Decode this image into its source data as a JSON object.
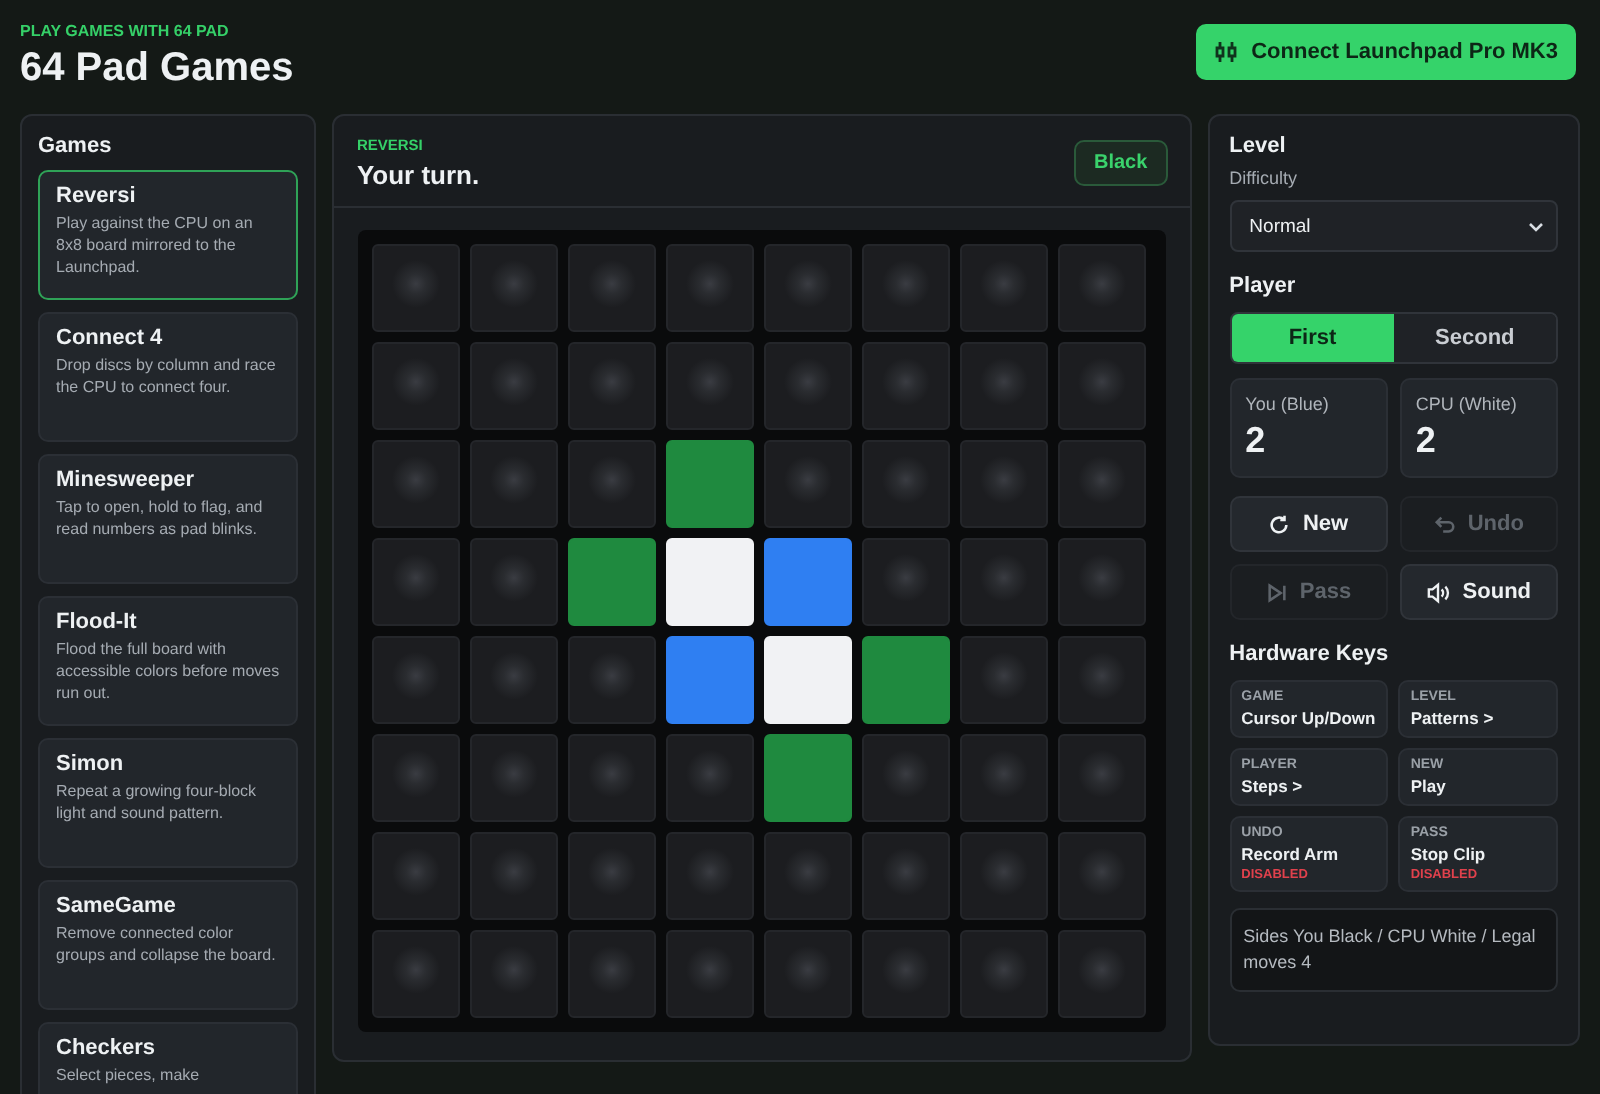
{
  "header": {
    "eyebrow": "PLAY GAMES WITH 64 PAD",
    "title": "64 Pad Games",
    "connect_button": "Connect Launchpad Pro MK3"
  },
  "sidebar": {
    "title": "Games",
    "items": [
      {
        "title": "Reversi",
        "description": "Play against the CPU on an 8x8 board mirrored to the Launchpad.",
        "selected": true
      },
      {
        "title": "Connect 4",
        "description": "Drop discs by column and race the CPU to connect four.",
        "selected": false
      },
      {
        "title": "Minesweeper",
        "description": "Tap to open, hold to flag, and read numbers as pad blinks.",
        "selected": false
      },
      {
        "title": "Flood-It",
        "description": "Flood the full board with accessible colors before moves run out.",
        "selected": false
      },
      {
        "title": "Simon",
        "description": "Repeat a growing four-block light and sound pattern.",
        "selected": false
      },
      {
        "title": "SameGame",
        "description": "Remove connected color groups and collapse the board.",
        "selected": false
      },
      {
        "title": "Checkers",
        "description": "Select pieces, make",
        "selected": false
      }
    ]
  },
  "game": {
    "eyebrow": "REVERSI",
    "status": "Your turn.",
    "side_badge": "Black",
    "board": [
      [
        {
          "kind": "empty"
        },
        {
          "kind": "empty"
        },
        {
          "kind": "empty"
        },
        {
          "kind": "empty"
        },
        {
          "kind": "empty"
        },
        {
          "kind": "empty"
        },
        {
          "kind": "empty"
        },
        {
          "kind": "empty"
        }
      ],
      [
        {
          "kind": "empty"
        },
        {
          "kind": "empty"
        },
        {
          "kind": "empty"
        },
        {
          "kind": "empty"
        },
        {
          "kind": "empty"
        },
        {
          "kind": "empty"
        },
        {
          "kind": "empty"
        },
        {
          "kind": "empty"
        }
      ],
      [
        {
          "kind": "empty"
        },
        {
          "kind": "empty"
        },
        {
          "kind": "empty"
        },
        {
          "kind": "hint"
        },
        {
          "kind": "empty"
        },
        {
          "kind": "empty"
        },
        {
          "kind": "empty"
        },
        {
          "kind": "empty"
        }
      ],
      [
        {
          "kind": "empty"
        },
        {
          "kind": "empty"
        },
        {
          "kind": "hint"
        },
        {
          "kind": "cpu"
        },
        {
          "kind": "player"
        },
        {
          "kind": "empty"
        },
        {
          "kind": "empty"
        },
        {
          "kind": "empty"
        }
      ],
      [
        {
          "kind": "empty"
        },
        {
          "kind": "empty"
        },
        {
          "kind": "empty"
        },
        {
          "kind": "player"
        },
        {
          "kind": "cpu"
        },
        {
          "kind": "hint"
        },
        {
          "kind": "empty"
        },
        {
          "kind": "empty"
        }
      ],
      [
        {
          "kind": "empty"
        },
        {
          "kind": "empty"
        },
        {
          "kind": "empty"
        },
        {
          "kind": "empty"
        },
        {
          "kind": "hint"
        },
        {
          "kind": "empty"
        },
        {
          "kind": "empty"
        },
        {
          "kind": "empty"
        }
      ],
      [
        {
          "kind": "empty"
        },
        {
          "kind": "empty"
        },
        {
          "kind": "empty"
        },
        {
          "kind": "empty"
        },
        {
          "kind": "empty"
        },
        {
          "kind": "empty"
        },
        {
          "kind": "empty"
        },
        {
          "kind": "empty"
        }
      ],
      [
        {
          "kind": "empty"
        },
        {
          "kind": "empty"
        },
        {
          "kind": "empty"
        },
        {
          "kind": "empty"
        },
        {
          "kind": "empty"
        },
        {
          "kind": "empty"
        },
        {
          "kind": "empty"
        },
        {
          "kind": "empty"
        }
      ]
    ]
  },
  "controls": {
    "level_title": "Level",
    "difficulty_label": "Difficulty",
    "difficulty_value": "Normal",
    "player_title": "Player",
    "player_options": [
      {
        "label": "First",
        "selected": true
      },
      {
        "label": "Second",
        "selected": false
      }
    ],
    "scores": [
      {
        "label": "You (Blue)",
        "value": "2"
      },
      {
        "label": "CPU (White)",
        "value": "2"
      }
    ],
    "buttons": [
      {
        "kind": "new",
        "label": "New",
        "disabled": false
      },
      {
        "kind": "undo",
        "label": "Undo",
        "disabled": true
      },
      {
        "kind": "pass",
        "label": "Pass",
        "disabled": true
      },
      {
        "kind": "sound",
        "label": "Sound",
        "disabled": false
      }
    ],
    "hardware_title": "Hardware Keys",
    "hardware_keys": [
      {
        "key": "GAME",
        "action": "Cursor Up/Down"
      },
      {
        "key": "LEVEL",
        "action": "Patterns >"
      },
      {
        "key": "PLAYER",
        "action": "Steps >"
      },
      {
        "key": "NEW",
        "action": "Play"
      },
      {
        "key": "UNDO",
        "action": "Record Arm",
        "status": "DISABLED"
      },
      {
        "key": "PASS",
        "action": "Stop Clip",
        "status": "DISABLED"
      }
    ],
    "note": "Sides You Black / CPU White / Legal moves 4"
  }
}
